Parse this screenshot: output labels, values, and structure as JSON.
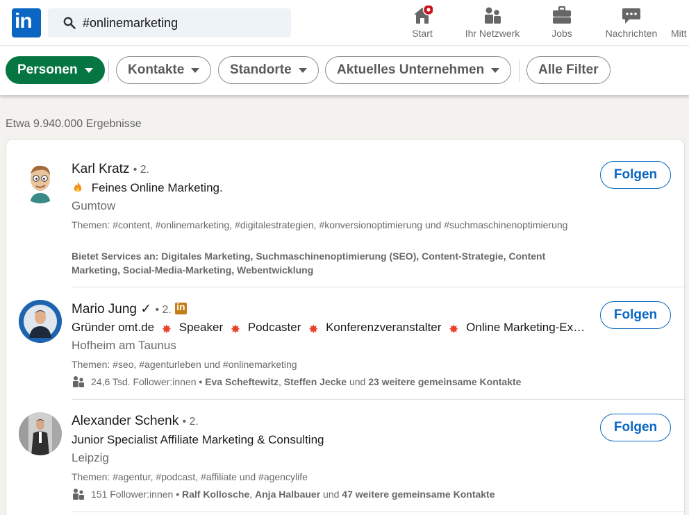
{
  "header": {
    "search": {
      "value": "#onlinemarketing"
    },
    "nav": [
      {
        "label": "Start",
        "icon": "home-icon"
      },
      {
        "label": "Ihr Netzwerk",
        "icon": "network-icon"
      },
      {
        "label": "Jobs",
        "icon": "briefcase-icon"
      },
      {
        "label": "Nachrichten",
        "icon": "messaging-icon"
      },
      {
        "label": "Mitt",
        "icon": "bell-icon"
      }
    ]
  },
  "filters": [
    {
      "label": "Personen",
      "active": true
    },
    {
      "label": "Kontakte"
    },
    {
      "label": "Standorte"
    },
    {
      "label": "Aktuelles Unternehmen"
    },
    {
      "label": "Alle Filter"
    }
  ],
  "result_count": "Etwa 9.940.000 Ergebnisse",
  "results": [
    {
      "name": "Karl Kratz",
      "degree": "• 2.",
      "headline": "Feines Online Marketing.",
      "location": "Gumtow",
      "topics": "Themen: #content, #onlinemarketing, #digitalestrategien, #konversionoptimierung und #suchmaschinenoptimierung",
      "services_label": "Bietet Services an:",
      "services": "Digitales Marketing, Suchmaschinenoptimierung (SEO), Content-Strategie, Content Marketing, Social-Media-Marketing, Webentwicklung",
      "follow_label": "Folgen"
    },
    {
      "name": "Mario Jung",
      "verified": "✓",
      "degree": "• 2.",
      "headline_parts": [
        "Gründer omt.de",
        "Speaker",
        "Podcaster",
        "Konferenzveranstalter",
        "Online Marketing-Ex…"
      ],
      "location": "Hofheim am Taunus",
      "topics": "Themen: #seo, #agenturleben und #onlinemarketing",
      "followers": "24,6 Tsd. Follower:innen",
      "mutual_1": "Eva Scheftewitz",
      "mutual_sep": ",",
      "mutual_2": "Steffen Jecke",
      "mutual_and": "und",
      "mutual_more": "23 weitere gemeinsame Kontakte",
      "follow_label": "Folgen"
    },
    {
      "name": "Alexander Schenk",
      "degree": "• 2.",
      "headline": "Junior Specialist Affiliate Marketing & Consulting",
      "location": "Leipzig",
      "topics": "Themen: #agentur, #podcast, #affiliate und #agencylife",
      "followers": "151 Follower:innen",
      "mutual_1": "Ralf Kollosche",
      "mutual_sep": ",",
      "mutual_2": "Anja Halbauer",
      "mutual_and": "und",
      "mutual_more": "47 weitere gemeinsame Kontakte",
      "follow_label": "Folgen"
    }
  ],
  "colors": {
    "brand": "#0a66c2",
    "active_filter": "#057642",
    "notification": "#cc1016"
  }
}
